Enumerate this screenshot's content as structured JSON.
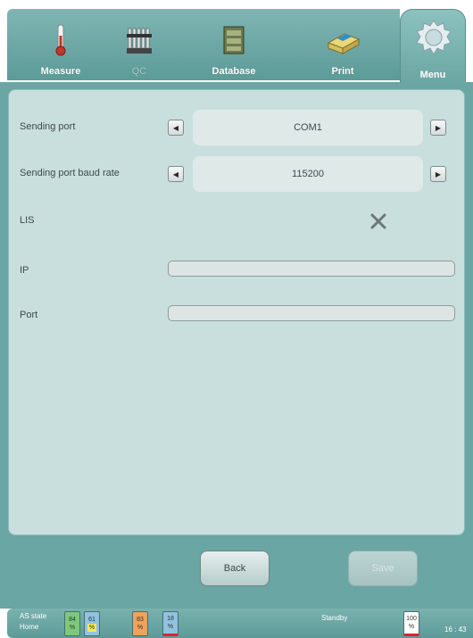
{
  "tabs": [
    {
      "label": "Measure",
      "icon": "thermometer-icon",
      "enabled": true
    },
    {
      "label": "QC",
      "icon": "tube-rack-icon",
      "enabled": false
    },
    {
      "label": "Database",
      "icon": "database-icon",
      "enabled": true
    },
    {
      "label": "Print",
      "icon": "printer-icon",
      "enabled": true
    },
    {
      "label": "Menu",
      "icon": "gear-icon",
      "enabled": true,
      "active": true
    }
  ],
  "form": {
    "sending_port": {
      "label": "Sending port",
      "value": "COM1"
    },
    "baud_rate": {
      "label": "Sending port baud rate",
      "value": "115200"
    },
    "lis": {
      "label": "LIS",
      "checked": false
    },
    "ip": {
      "label": "IP",
      "value": ""
    },
    "port": {
      "label": "Port",
      "value": ""
    }
  },
  "buttons": {
    "back": "Back",
    "save": "Save"
  },
  "status": {
    "as_state_line1": "AS state",
    "as_state_line2": "Home",
    "levels": [
      {
        "value": "84",
        "unit": "%",
        "color": "#7cc97a"
      },
      {
        "value": "61",
        "unit": "%",
        "color": "#f2ea5a"
      },
      {
        "value": "83",
        "unit": "%",
        "color": "#f0a15a"
      },
      {
        "value": "18",
        "unit": "%",
        "color": "#8fc3e0"
      }
    ],
    "standby": "Standby",
    "paper": {
      "value": "100",
      "unit": "%"
    },
    "time": "16 : 43"
  },
  "colors": {
    "teal_dark": "#5c9b98",
    "panel": "#c9dfde"
  }
}
